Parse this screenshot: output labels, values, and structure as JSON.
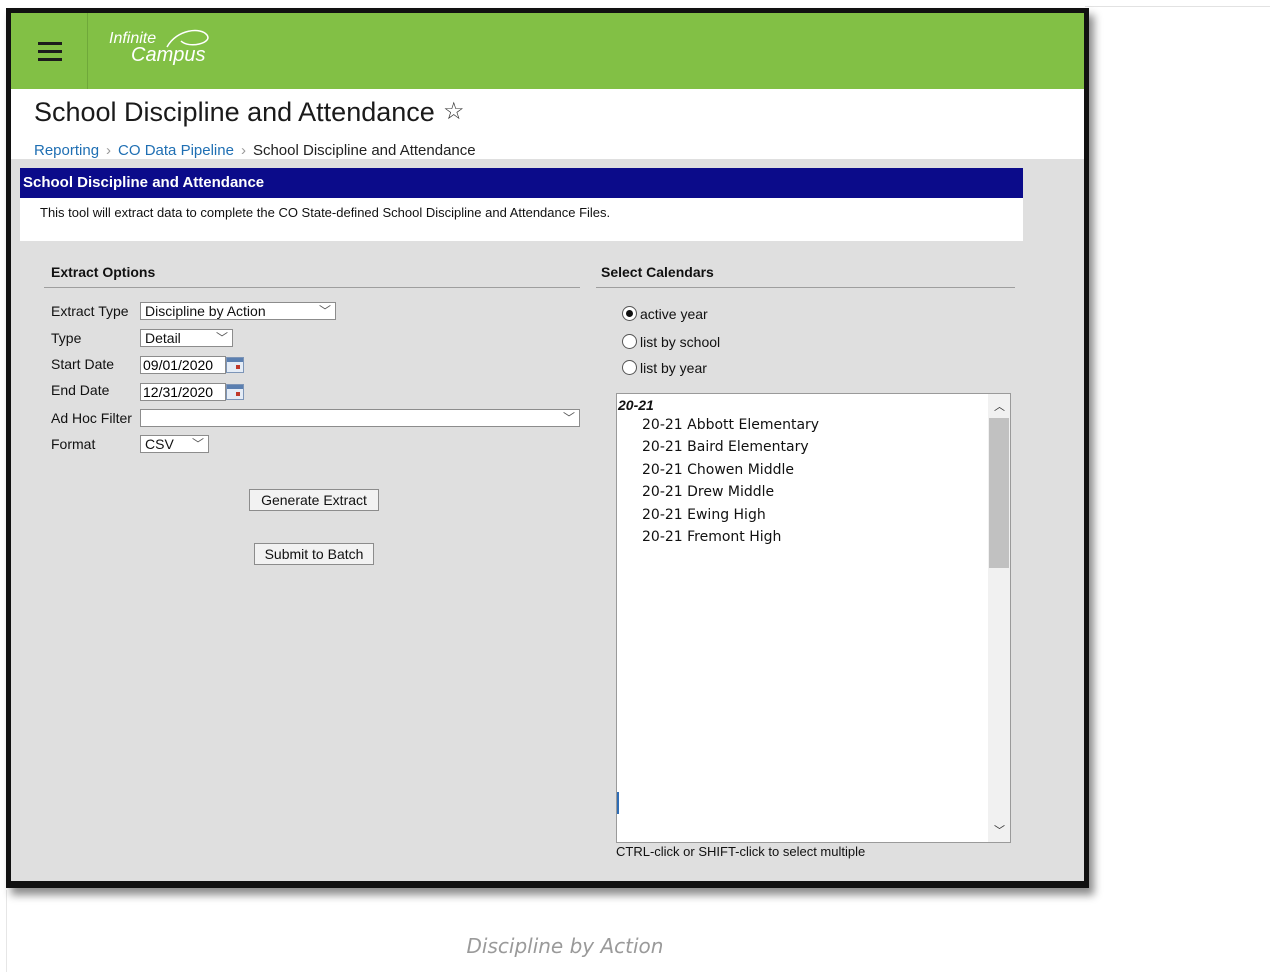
{
  "app": {
    "logo_line1": "Infinite",
    "logo_line2": "Campus"
  },
  "header": {
    "title": "School Discipline and Attendance",
    "breadcrumb": [
      "Reporting",
      "CO Data Pipeline",
      "School Discipline and Attendance"
    ]
  },
  "panel": {
    "title": "School Discipline and Attendance",
    "description": "This tool will extract data to complete the CO State-defined School Discipline and Attendance Files."
  },
  "extract_options": {
    "heading": "Extract Options",
    "extract_type_label": "Extract Type",
    "extract_type_value": "Discipline by Action",
    "type_label": "Type",
    "type_value": "Detail",
    "start_date_label": "Start Date",
    "start_date_value": "09/01/2020",
    "end_date_label": "End Date",
    "end_date_value": "12/31/2020",
    "ad_hoc_label": "Ad Hoc Filter",
    "ad_hoc_value": "",
    "format_label": "Format",
    "format_value": "CSV",
    "generate_label": "Generate Extract",
    "batch_label": "Submit to Batch"
  },
  "calendars": {
    "heading": "Select Calendars",
    "radio_active": "active year",
    "radio_school": "list by school",
    "radio_year": "list by year",
    "group": "20-21",
    "items": [
      "20-21 Abbott Elementary",
      "20-21 Baird Elementary",
      "20-21 Chowen Middle",
      "20-21 Drew Middle",
      "20-21 Ewing High",
      "20-21 Fremont High"
    ],
    "hint": "CTRL-click or SHIFT-click to select multiple"
  },
  "caption": "Discipline by Action",
  "colors": {
    "topbar": "#82c045",
    "panel_header": "#0b0b8a",
    "link": "#1f6fb3"
  },
  "icons": {
    "menu": "hamburger-icon",
    "favorite": "star-outline-icon",
    "date": "calendar-icon"
  }
}
